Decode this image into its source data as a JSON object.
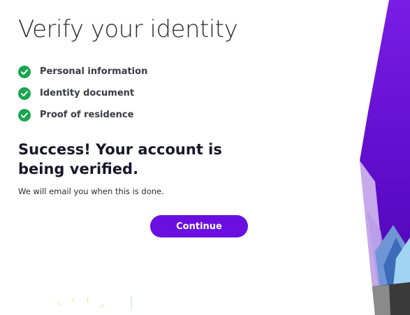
{
  "title": "Verify your identity",
  "steps": [
    {
      "label": "Personal information",
      "status": "complete"
    },
    {
      "label": "Identity document",
      "status": "complete"
    },
    {
      "label": "Proof of residence",
      "status": "complete"
    }
  ],
  "headline": "Success! Your account is being verified.",
  "subtext": "We will email you when this is done.",
  "continue_label": "Continue",
  "colors": {
    "accent": "#6a0fe0",
    "check": "#1aa551",
    "text": "#17172a"
  },
  "icons": {
    "step_check": "check-circle-icon"
  }
}
